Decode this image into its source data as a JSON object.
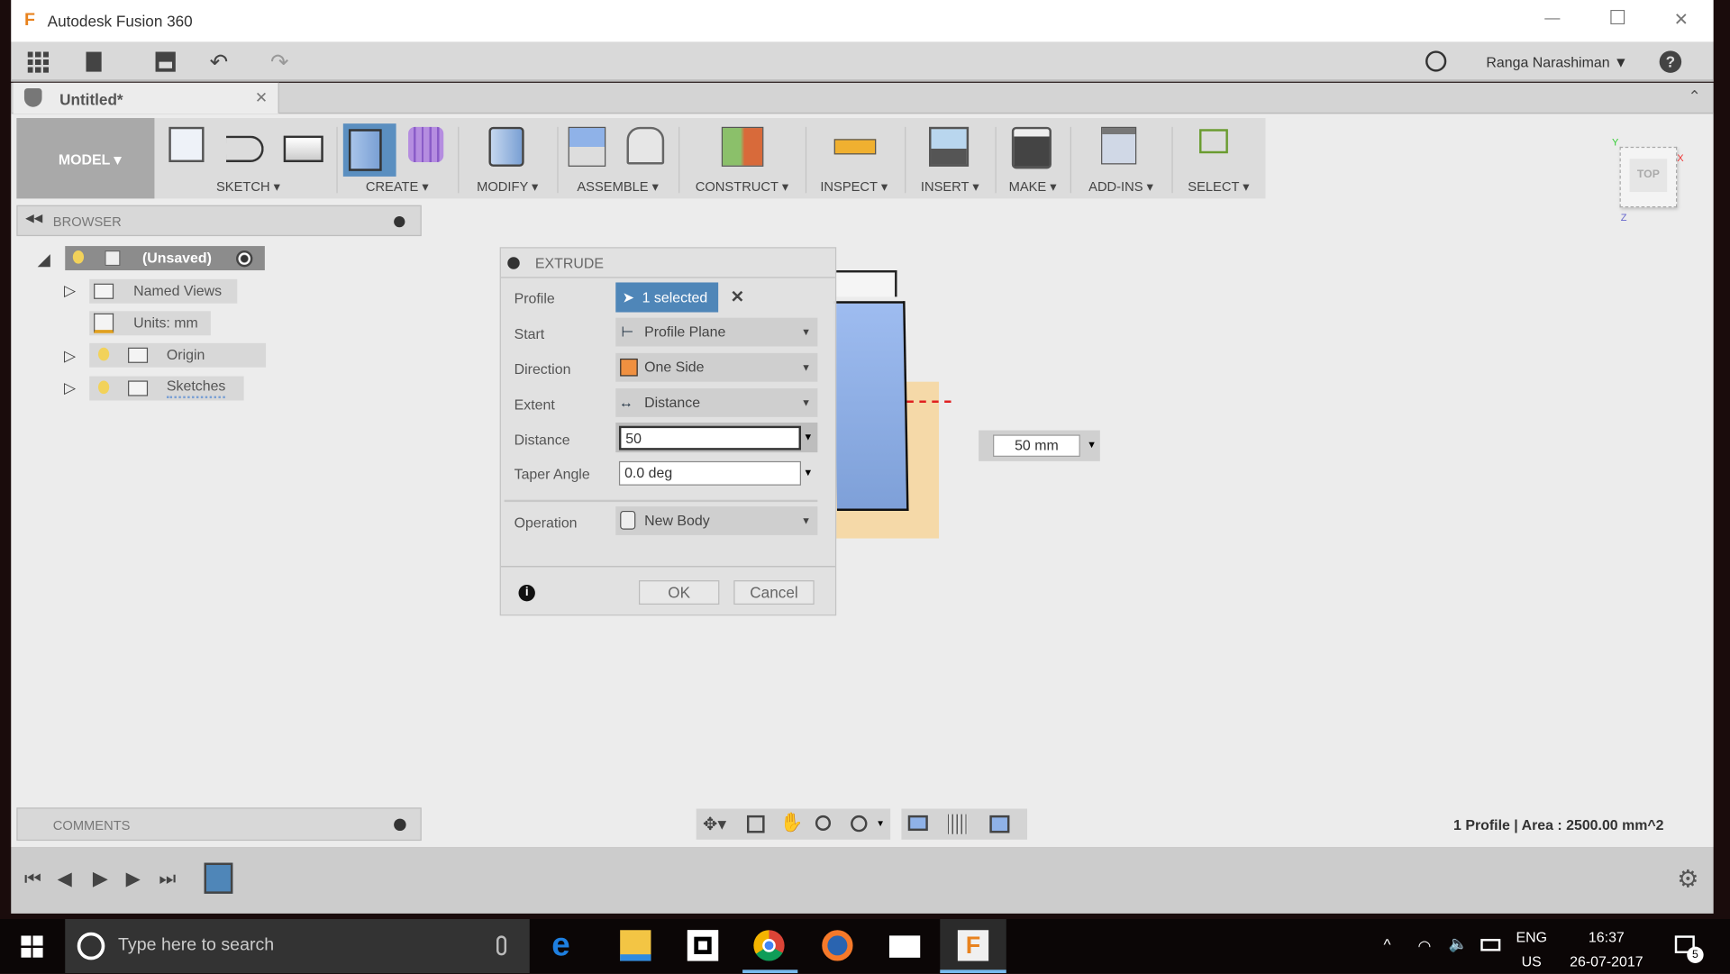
{
  "window": {
    "title": "Autodesk Fusion 360",
    "minimize": "—",
    "maximize": "☐",
    "close": "✕"
  },
  "quickbar": {
    "user": "Ranga Narashiman ▼",
    "help": "?"
  },
  "doc_tab": {
    "label": "Untitled*",
    "close": "✕"
  },
  "ribbon": {
    "workspace": "MODEL ▾",
    "groups": [
      "SKETCH ▾",
      "CREATE ▾",
      "MODIFY ▾",
      "ASSEMBLE ▾",
      "CONSTRUCT ▾",
      "INSPECT ▾",
      "INSERT ▾",
      "MAKE ▾",
      "ADD-INS ▾",
      "SELECT ▾"
    ]
  },
  "viewcube": {
    "face": "TOP",
    "x": "X",
    "y": "Y",
    "z": "Z"
  },
  "browser": {
    "title": "BROWSER",
    "root": "(Unsaved)",
    "items": [
      "Named Views",
      "Units: mm",
      "Origin",
      "Sketches"
    ]
  },
  "extrude": {
    "title": "EXTRUDE",
    "profile_label": "Profile",
    "profile_value": "1 selected",
    "start_label": "Start",
    "start_value": "Profile Plane",
    "direction_label": "Direction",
    "direction_value": "One Side",
    "extent_label": "Extent",
    "extent_value": "Distance",
    "distance_label": "Distance",
    "distance_value": "50",
    "taper_label": "Taper Angle",
    "taper_value": "0.0 deg",
    "operation_label": "Operation",
    "operation_value": "New Body",
    "ok": "OK",
    "cancel": "Cancel"
  },
  "manipulator": {
    "value": "50 mm"
  },
  "comments": {
    "title": "COMMENTS"
  },
  "status": {
    "text": "1 Profile | Area : 2500.00 mm^2"
  },
  "taskbar": {
    "search_placeholder": "Type here to search",
    "lang1": "ENG",
    "lang2": "US",
    "time": "16:37",
    "date": "26-07-2017",
    "notif_count": "5"
  },
  "colors": {
    "accent": "#5b8fc0",
    "selected_bg": "#4f86b8",
    "profile_blue": "#8fb2e8",
    "sketch_orange": "#f5d6a0"
  }
}
